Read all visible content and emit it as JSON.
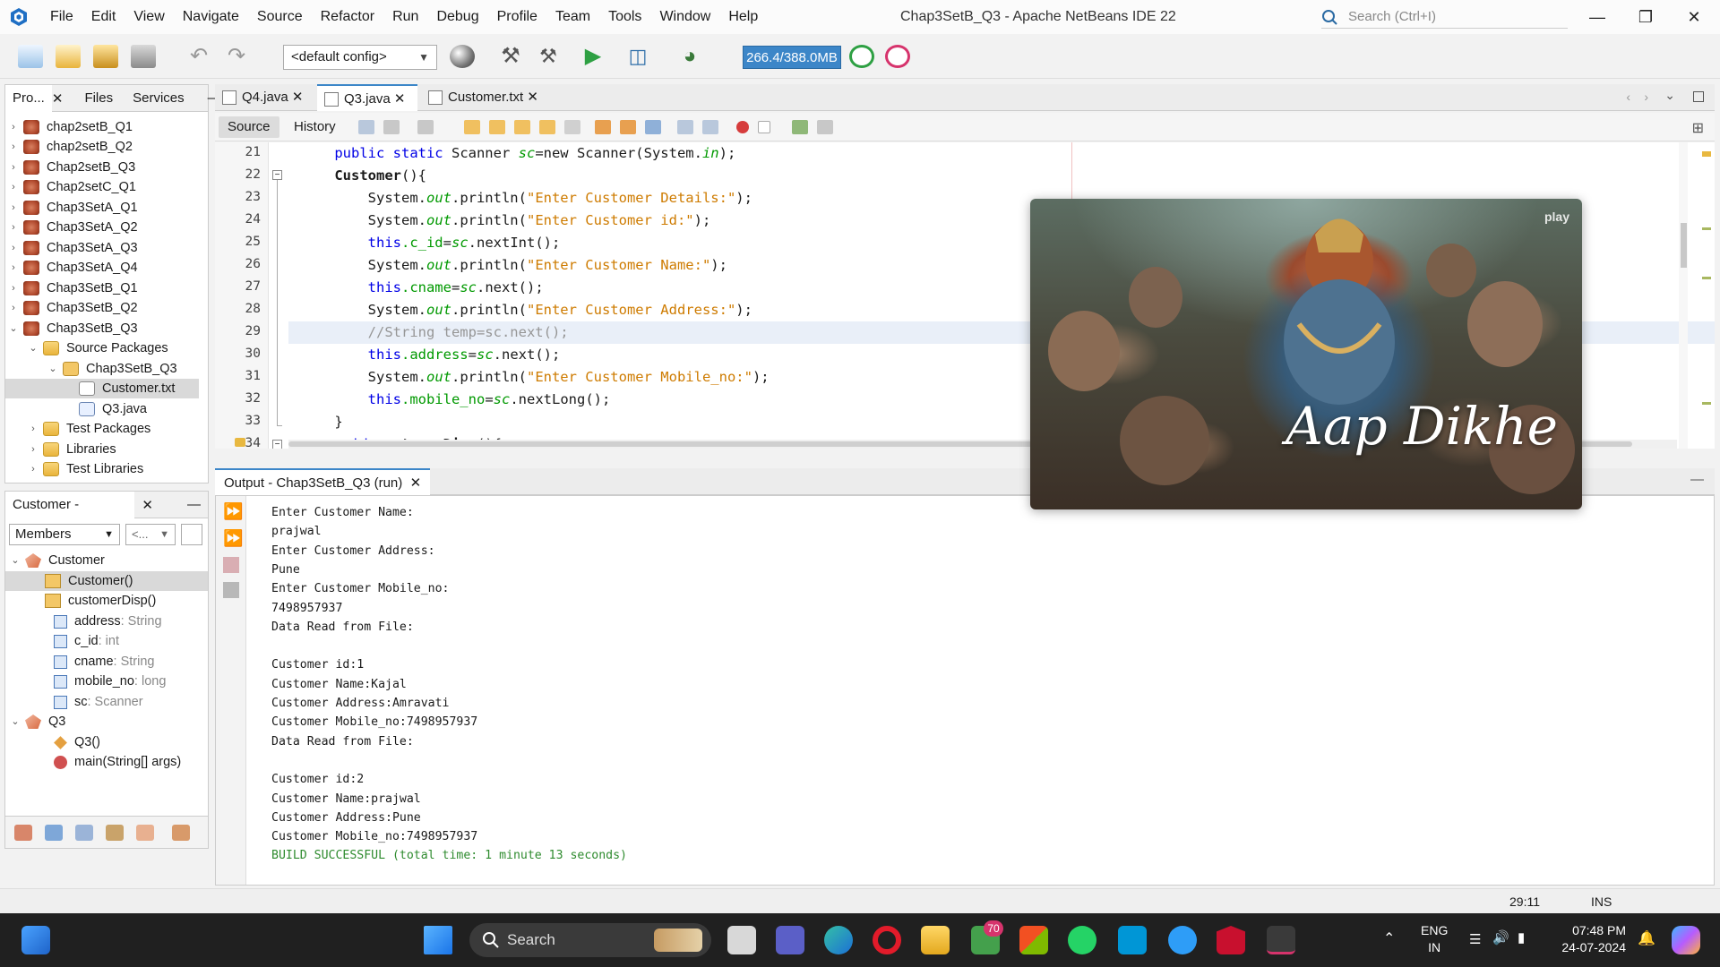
{
  "window": {
    "title": "Chap3SetB_Q3 - Apache NetBeans IDE 22",
    "search_placeholder": "Search (Ctrl+I)",
    "menu": [
      "File",
      "Edit",
      "View",
      "Navigate",
      "Source",
      "Refactor",
      "Run",
      "Debug",
      "Profile",
      "Team",
      "Tools",
      "Window",
      "Help"
    ]
  },
  "toolbar": {
    "config": "<default config>",
    "memory": "266.4/388.0MB"
  },
  "projects_panel": {
    "tabs": [
      "Pro...",
      "Files",
      "Services"
    ],
    "items": [
      {
        "label": "chap2setB_Q1"
      },
      {
        "label": "chap2setB_Q2"
      },
      {
        "label": "Chap2setB_Q3"
      },
      {
        "label": "Chap2setC_Q1"
      },
      {
        "label": "Chap3SetA_Q1"
      },
      {
        "label": "Chap3SetA_Q2"
      },
      {
        "label": "Chap3SetA_Q3"
      },
      {
        "label": "Chap3SetA_Q4"
      },
      {
        "label": "Chap3SetB_Q1"
      },
      {
        "label": "Chap3SetB_Q2"
      },
      {
        "label": "Chap3SetB_Q3"
      },
      {
        "label": "Source Packages"
      },
      {
        "label": "Chap3SetB_Q3"
      },
      {
        "label": "Customer.txt"
      },
      {
        "label": "Q3.java"
      },
      {
        "label": "Test Packages"
      },
      {
        "label": "Libraries"
      },
      {
        "label": "Test Libraries"
      }
    ]
  },
  "navigator": {
    "title": "Customer - Navigator",
    "filter": "Members",
    "filter2": "<...",
    "members": [
      {
        "label": "Customer",
        "type": ""
      },
      {
        "label": "Customer()",
        "type": ""
      },
      {
        "label": "customerDisp()",
        "type": ""
      },
      {
        "label": "address",
        "type": " : String"
      },
      {
        "label": "c_id",
        "type": " : int"
      },
      {
        "label": "cname",
        "type": " : String"
      },
      {
        "label": "mobile_no",
        "type": " : long"
      },
      {
        "label": "sc",
        "type": " : Scanner"
      },
      {
        "label": "Q3",
        "type": ""
      },
      {
        "label": "Q3()",
        "type": ""
      },
      {
        "label": "main",
        "type": "(String[] args)"
      }
    ]
  },
  "editor": {
    "tabs": [
      "Q4.java",
      "Q3.java",
      "Customer.txt"
    ],
    "active_tab": "Q3.java",
    "subtabs": [
      "Source",
      "History"
    ],
    "line_numbers": [
      "21",
      "22",
      "23",
      "24",
      "25",
      "26",
      "27",
      "28",
      "29",
      "30",
      "31",
      "32",
      "33",
      "34"
    ],
    "code": {
      "l21a": "    public static ",
      "l21b": "Scanner ",
      "l21c": "sc",
      "l21d": "=new Scanner(System.",
      "l21e": "in",
      "l21f": ");",
      "l22": "    Customer",
      "l22b": "(){",
      "l23a": "        System.",
      "l23b": "out",
      "l23c": ".println(",
      "l23d": "\"Enter Customer Details:\"",
      "l23e": ");",
      "l24a": "        System.",
      "l24b": "out",
      "l24c": ".println(",
      "l24d": "\"Enter Customer id:\"",
      "l24e": ");",
      "l25a": "        this",
      "l25b": ".c_id",
      "l25c": "=",
      "l25d": "sc",
      "l25e": ".nextInt();",
      "l26a": "        System.",
      "l26b": "out",
      "l26c": ".println(",
      "l26d": "\"Enter Customer Name:\"",
      "l26e": ");",
      "l27a": "        this",
      "l27b": ".cname",
      "l27c": "=",
      "l27d": "sc",
      "l27e": ".next();",
      "l28a": "        System.",
      "l28b": "out",
      "l28c": ".println(",
      "l28d": "\"Enter Customer Address:\"",
      "l28e": ");",
      "l29": "        //String temp=sc.next();",
      "l30a": "        this",
      "l30b": ".address",
      "l30c": "=",
      "l30d": "sc",
      "l30e": ".next();",
      "l31a": "        System.",
      "l31b": "out",
      "l31c": ".println(",
      "l31d": "\"Enter Customer Mobile_no:\"",
      "l31e": ");",
      "l32a": "        this",
      "l32b": ".mobile_no",
      "l32c": "=",
      "l32d": "sc",
      "l32e": ".nextLong();",
      "l33": "    }",
      "l34a": "    void ",
      "l34b": "customerDisp",
      "l34c": "(){"
    }
  },
  "output": {
    "tab": "Output - Chap3SetB_Q3 (run)",
    "lines": [
      "Enter Customer Name:",
      "prajwal",
      "Enter Customer Address:",
      "Pune",
      "Enter Customer Mobile_no:",
      "7498957937",
      "Data Read from File:",
      "",
      "Customer id:1",
      "Customer Name:Kajal",
      "Customer Address:Amravati",
      "Customer Mobile_no:7498957937",
      "Data Read from File:",
      "",
      "Customer id:2",
      "Customer Name:prajwal",
      "Customer Address:Pune",
      "Customer Mobile_no:7498957937"
    ],
    "result": "BUILD SUCCESSFUL (total time: 1 minute 13 seconds)"
  },
  "statusbar": {
    "position": "29:11",
    "mode": "INS"
  },
  "video_overlay": {
    "caption": "Aap Dikhe",
    "brand": "play"
  },
  "taskbar": {
    "search_label": "Search",
    "store_badge": "70",
    "lang_line1": "ENG",
    "lang_line2": "IN",
    "time": "07:48 PM",
    "date": "24-07-2024"
  }
}
